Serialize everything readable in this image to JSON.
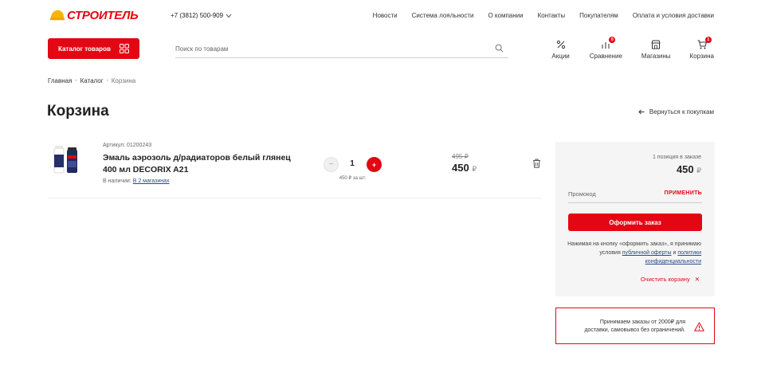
{
  "header": {
    "logo_text": "СТРОИТЕЛЬ",
    "phone": "+7 (3812) 500-909",
    "nav": [
      "Новости",
      "Система лояльности",
      "О компании",
      "Контакты",
      "Покупателям",
      "Оплата и условия доставки"
    ]
  },
  "toolbar": {
    "catalog_label": "Каталог товаров",
    "search_placeholder": "Поиск по товарам",
    "items": [
      {
        "label": "Акции",
        "icon": "percent-icon"
      },
      {
        "label": "Сравнение",
        "icon": "compare-icon",
        "badge": "0"
      },
      {
        "label": "Магазины",
        "icon": "store-icon"
      },
      {
        "label": "Корзина",
        "icon": "cart-icon",
        "badge": "1"
      }
    ]
  },
  "breadcrumb": [
    "Главная",
    "Каталог",
    "Корзина"
  ],
  "page": {
    "title": "Корзина",
    "back_label": "Вернуться к покупкам"
  },
  "cart_item": {
    "article": "Артикул: 01200243",
    "name": "Эмаль аэрозоль д/радиаторов белый глянец 400 мл DECORIX A21",
    "availability_prefix": "В наличии:",
    "availability_link": "В 2 магазинах",
    "qty": "1",
    "minus": "−",
    "plus": "+",
    "unit_price": "450 ₽ за шт.",
    "old_price": "495 ₽",
    "price": "450",
    "currency": "₽"
  },
  "summary": {
    "count": "1 позиция в заказе",
    "total": "450",
    "currency": "₽",
    "promo_placeholder": "Промокод",
    "apply_label": "ПРИМЕНИТЬ",
    "order_button": "Оформить заказ",
    "note_text": "Нажимая на кнопку «оформить заказ», я принимаю условия",
    "offer_link": "публичной оферты",
    "and": "и",
    "privacy_link": "политики конфиденциальности",
    "clear_label": "Очистить корзину",
    "clear_mark": "✕"
  },
  "notice": {
    "text": "Принимаем заказы от 2000₽ для доставки, самовывоз без ограничений."
  },
  "colors": {
    "accent": "#e30613",
    "link": "#2a4a8a",
    "summary_bg": "#f5f5f5"
  }
}
